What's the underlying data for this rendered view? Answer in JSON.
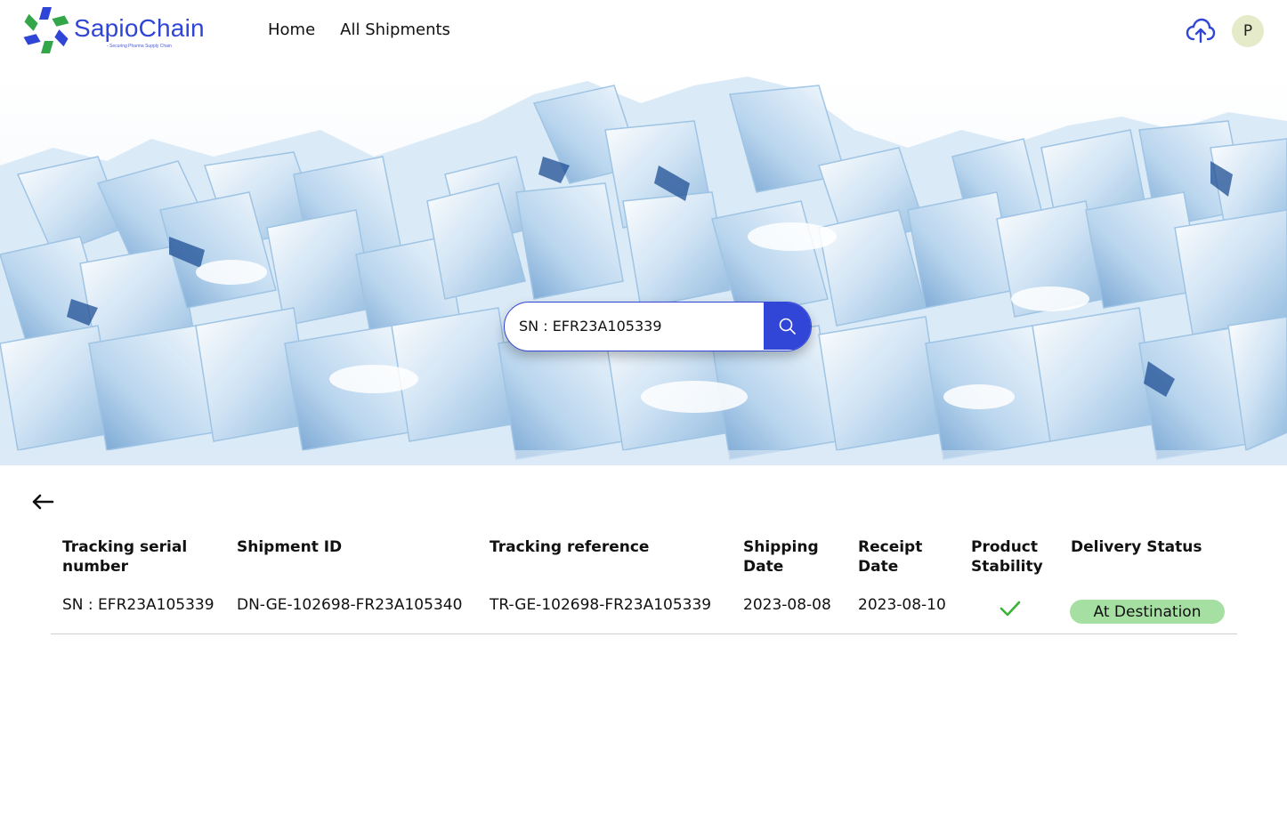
{
  "brand": {
    "name": "SapioChain",
    "tagline": "- Securing Pharma Supply Chain",
    "accent": "#3145d6"
  },
  "nav": {
    "items": [
      {
        "label": "Home"
      },
      {
        "label": "All Shipments"
      }
    ]
  },
  "header": {
    "upload_icon": "cloud-upload-icon",
    "avatar_initial": "P"
  },
  "search": {
    "value": "SN : EFR23A105339",
    "icon": "search-icon"
  },
  "table": {
    "columns": [
      "Tracking serial number",
      "Shipment ID",
      "Tracking reference",
      "Shipping Date",
      "Receipt Date",
      "Product Stability",
      "Delivery Status"
    ],
    "rows": [
      {
        "serial": "SN : EFR23A105339",
        "shipment_id": "DN-GE-102698-FR23A105340",
        "tracking_ref": "TR-GE-102698-FR23A105339",
        "shipping_date": "2023-08-08",
        "receipt_date": "2023-08-10",
        "stability_icon": "checkmark-icon",
        "status": "At Destination",
        "status_color": "#a6dfa2"
      }
    ]
  }
}
